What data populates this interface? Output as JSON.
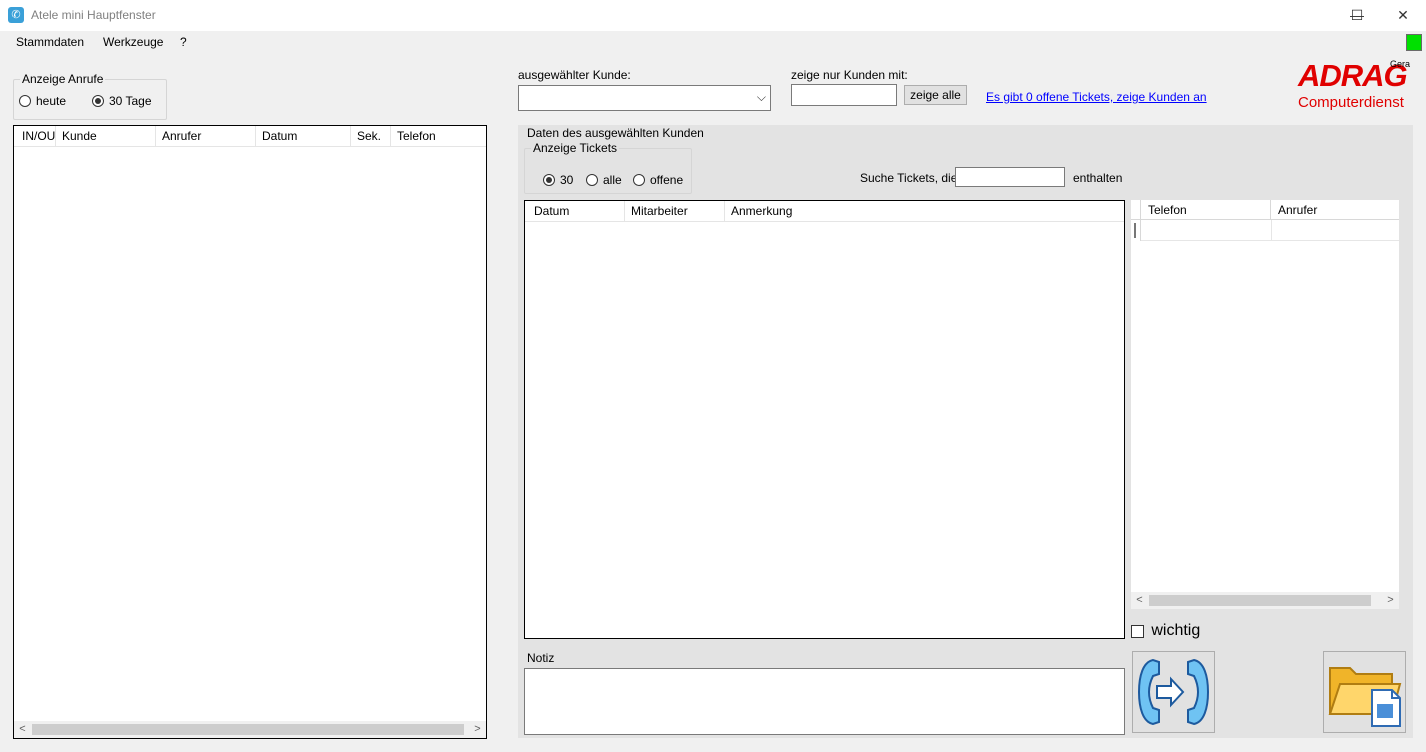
{
  "window": {
    "title": "Atele mini Hauptfenster",
    "icon": "phone-icon",
    "controls": {
      "minimize": "—",
      "maximize": "☐",
      "close": "✕"
    }
  },
  "menu": {
    "items": [
      "Stammdaten",
      "Werkzeuge",
      "?"
    ]
  },
  "status_color": "#00e000",
  "calls_filter": {
    "legend": "Anzeige Anrufe",
    "options": [
      {
        "label": "heute",
        "checked": false
      },
      {
        "label": "30 Tage",
        "checked": true
      }
    ]
  },
  "calls_table": {
    "columns": [
      "IN/OUT",
      "Kunde",
      "Anrufer",
      "Datum",
      "Sek.",
      "Telefon"
    ],
    "rows": []
  },
  "customer": {
    "label": "ausgewählter Kunde:",
    "value": "",
    "filter_label": "zeige nur Kunden mit:",
    "filter_value": "",
    "show_all_label": "zeige alle",
    "open_tickets_link": "Es gibt 0 offene Tickets, zeige Kunden an"
  },
  "logo": {
    "line1": "ADRAG",
    "city": "Gera",
    "line2": "Computerdienst",
    "color": "#e00000"
  },
  "customer_panel": {
    "legend": "Daten des ausgewählten Kunden",
    "tickets_filter": {
      "legend": "Anzeige Tickets",
      "options": [
        {
          "label": "30",
          "checked": true
        },
        {
          "label": "alle",
          "checked": false
        },
        {
          "label": "offene",
          "checked": false
        }
      ]
    },
    "search_label": "Suche Tickets, die",
    "search_value": "",
    "search_suffix": "enthalten",
    "tickets_table": {
      "columns": [
        "Datum",
        "Mitarbeiter",
        "Anmerkung"
      ],
      "rows": []
    },
    "phones_table": {
      "columns": [
        "Telefon",
        "Anrufer"
      ],
      "rows": []
    },
    "important_label": "wichtig",
    "note_label": "Notiz",
    "note_value": ""
  }
}
